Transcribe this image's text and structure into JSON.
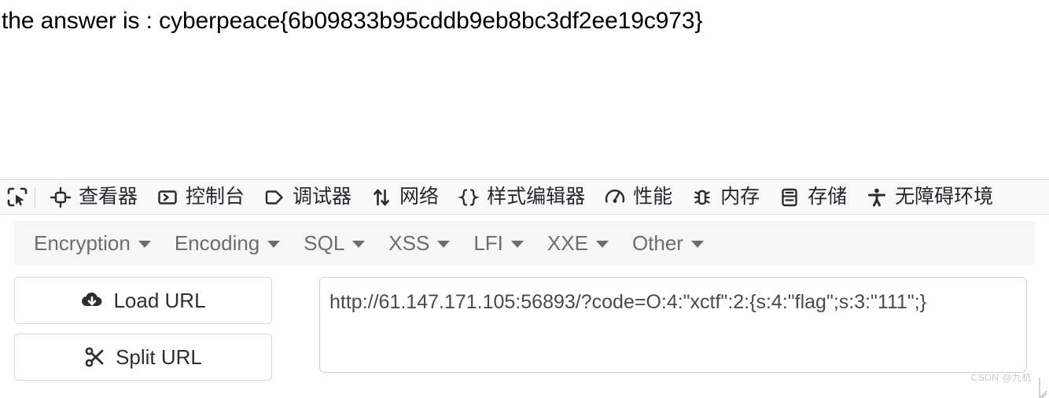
{
  "page": {
    "answer_text": "the answer is : cyberpeace{6b09833b95cddb9eb8bc3df2ee19c973}"
  },
  "devtools": {
    "picker_icon": "element-picker-icon",
    "tabs": [
      {
        "label": "查看器",
        "icon": "inspector-target-icon"
      },
      {
        "label": "控制台",
        "icon": "console-chevron-icon"
      },
      {
        "label": "调试器",
        "icon": "debugger-tag-icon"
      },
      {
        "label": "网络",
        "icon": "network-arrows-icon"
      },
      {
        "label": "样式编辑器",
        "icon": "style-editor-braces-icon"
      },
      {
        "label": "性能",
        "icon": "performance-gauge-icon"
      },
      {
        "label": "内存",
        "icon": "memory-chip-icon"
      },
      {
        "label": "存储",
        "icon": "storage-database-icon"
      },
      {
        "label": "无障碍环境",
        "icon": "accessibility-person-icon"
      }
    ]
  },
  "hackbar": {
    "menu": [
      {
        "label": "Encryption"
      },
      {
        "label": "Encoding"
      },
      {
        "label": "SQL"
      },
      {
        "label": "XSS"
      },
      {
        "label": "LFI"
      },
      {
        "label": "XXE"
      },
      {
        "label": "Other"
      }
    ],
    "buttons": [
      {
        "label": "Load URL",
        "icon": "cloud-download-icon"
      },
      {
        "label": "Split URL",
        "icon": "scissors-icon"
      }
    ],
    "url_value": "http://61.147.171.105:56893/?code=O:4:\"xctf\":2:{s:4:\"flag\";s:3:\"111\";}"
  },
  "watermark": {
    "text": "CSDN @九杭"
  },
  "colors": {
    "toolbar_bg": "#f9f9fa",
    "menu_bg": "#f6f6f6",
    "menu_text": "#6d6d6d",
    "tab_text": "#27272b",
    "url_text": "#4a4a4a",
    "page_bg": "#ffffff"
  }
}
